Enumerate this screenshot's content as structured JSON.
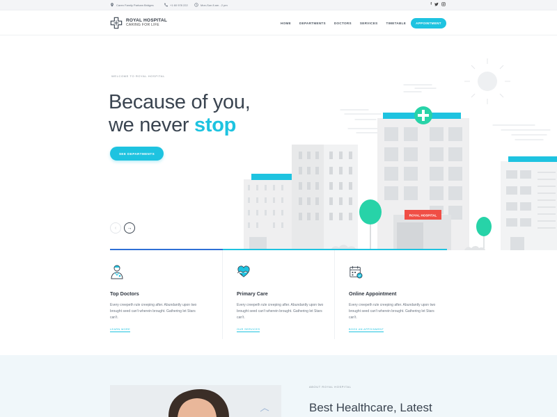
{
  "topbar": {
    "address": "Caren Family Parham Bridges",
    "phone": "+1 60 978 222",
    "hours": "Mon-Sun 8 am - 2 pm",
    "social": [
      "f",
      "t",
      "ig"
    ]
  },
  "header": {
    "logo_name": "ROYAL HOSPITAL",
    "logo_tagline": "CARING FOR LIFE",
    "nav": [
      "HOME",
      "DEPARTMENTS",
      "DOCTORS",
      "SERVICES",
      "TIMETABLE"
    ],
    "appointment_label": "APPOINTMENT"
  },
  "hero": {
    "welcome": "WELCOME TO ROYAL HOSPITAL",
    "headline_line1": "Because of you,",
    "headline_line2_plain": "we never ",
    "headline_line2_accent": "stop",
    "cta_label": "SEE DEPARTMENTS",
    "prev_arrow": "‹",
    "next_arrow": "→",
    "sign_text": "ROYAL HOSPITAL"
  },
  "features": [
    {
      "icon": "doctor-icon",
      "title": "Top Doctors",
      "desc": "Every creepeth rule creeping after. Abundantly upon two brought seed can't wherein brought. Gathering let Stars can't.",
      "link": "LEARN MORE"
    },
    {
      "icon": "heart-hands-icon",
      "title": "Primary Care",
      "desc": "Every creepeth rule creeping after. Abundantly upon two brought seed can't wherein brought. Gathering let Stars can't.",
      "link": "OUR SERVICES"
    },
    {
      "icon": "calendar-check-icon",
      "title": "Online Appointment",
      "desc": "Every creepeth rule creeping after. Abundantly upon two brought seed can't wherein brought. Gathering let Stars can't.",
      "link": "BOOK AN APPOINMENT"
    }
  ],
  "about": {
    "label": "ABOUT ROYAL HOSPITAL",
    "heading": "Best Healthcare, Latest"
  },
  "colors": {
    "accent": "#1ec3e0",
    "dark": "#3a4450",
    "sign_red": "#f04e45",
    "tree_green": "#27d3a8"
  }
}
